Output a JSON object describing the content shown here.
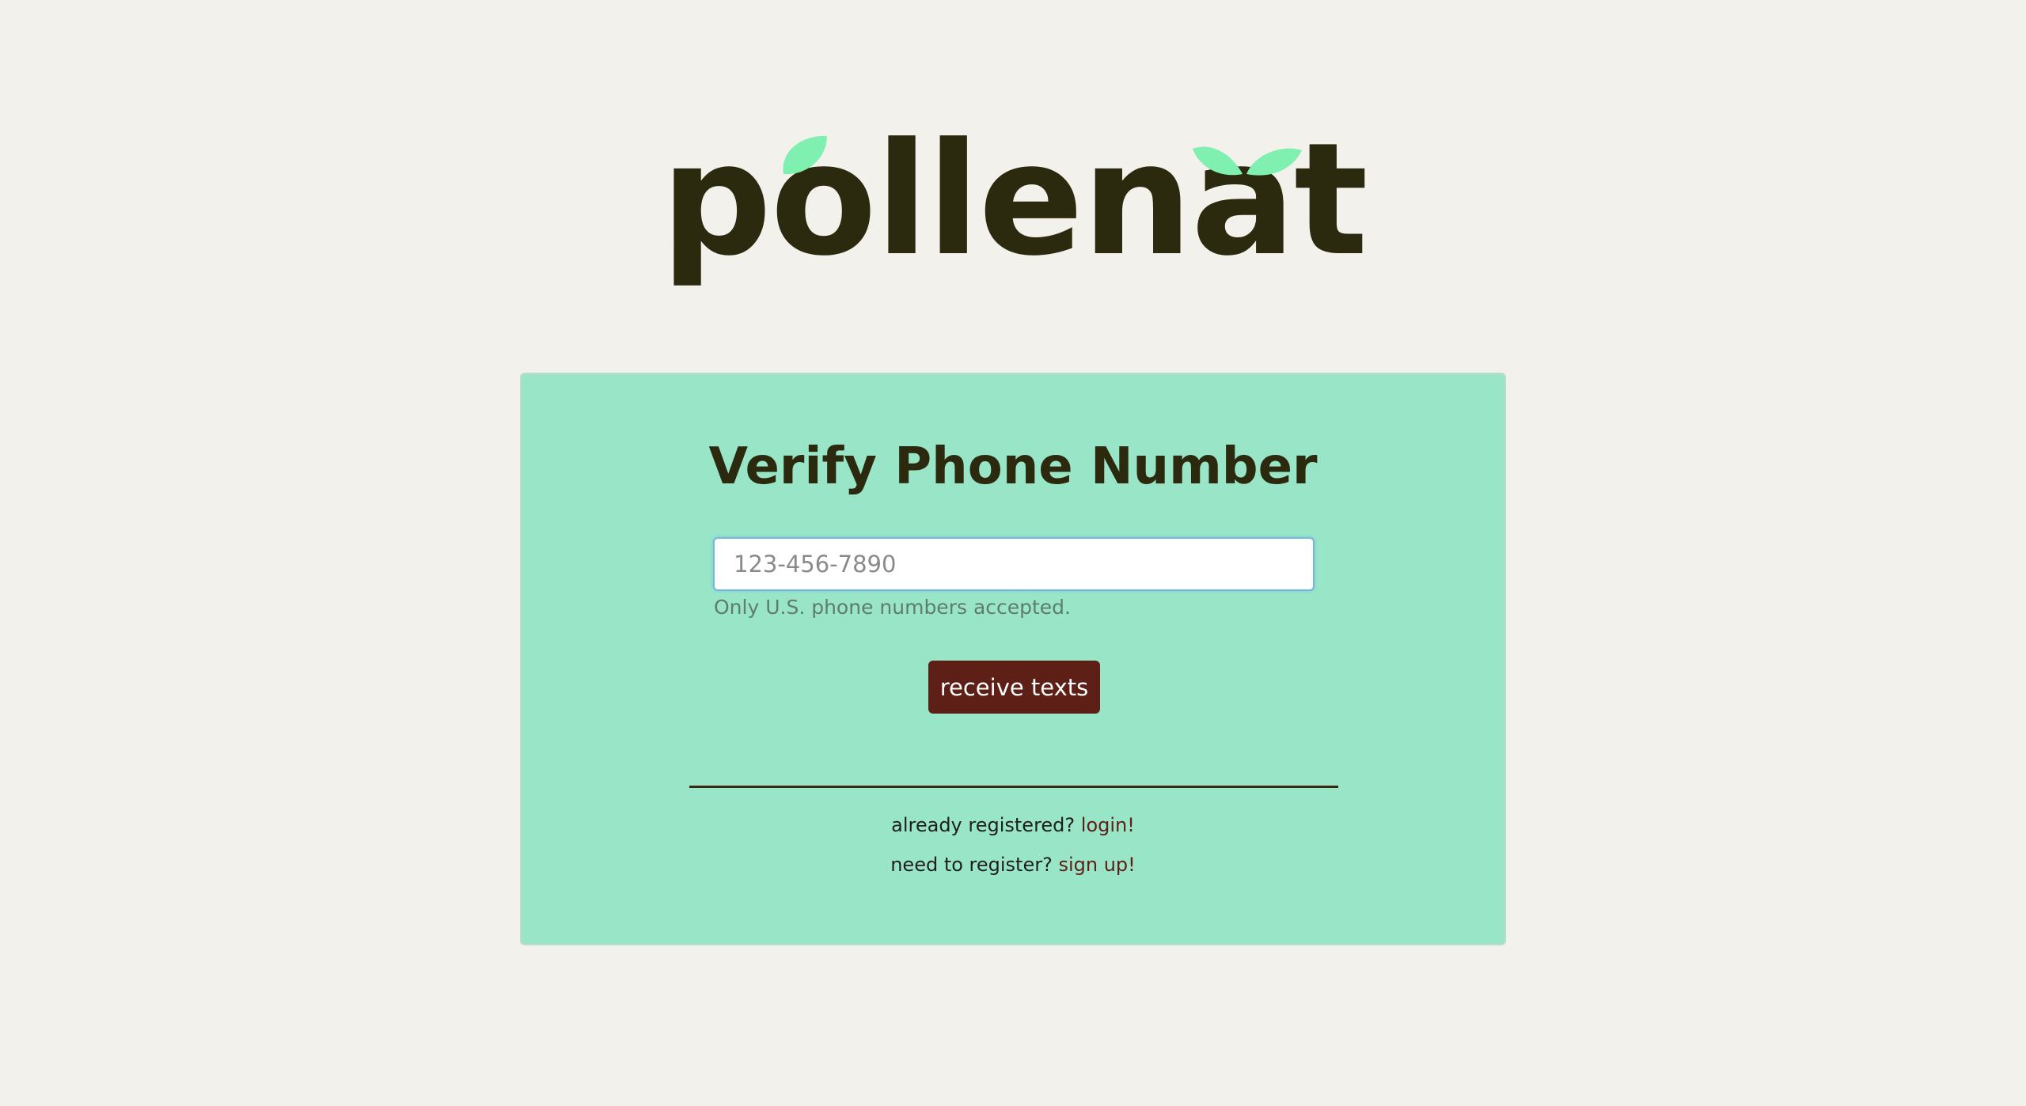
{
  "brand": {
    "logo_text": "pollenate",
    "text_color": "#2c2a0e",
    "leaf_color": "#7ff0b0"
  },
  "card": {
    "title": "Verify Phone Number",
    "background": "#99e5c7"
  },
  "phone": {
    "value": "",
    "placeholder": "123-456-7890",
    "help_text": "Only U.S. phone numbers accepted."
  },
  "submit": {
    "label": "receive texts",
    "color": "#5e1f16"
  },
  "footer": {
    "login_prompt": "already registered?",
    "login_link": "login!",
    "signup_prompt": "need to register?",
    "signup_link": "sign up!"
  }
}
